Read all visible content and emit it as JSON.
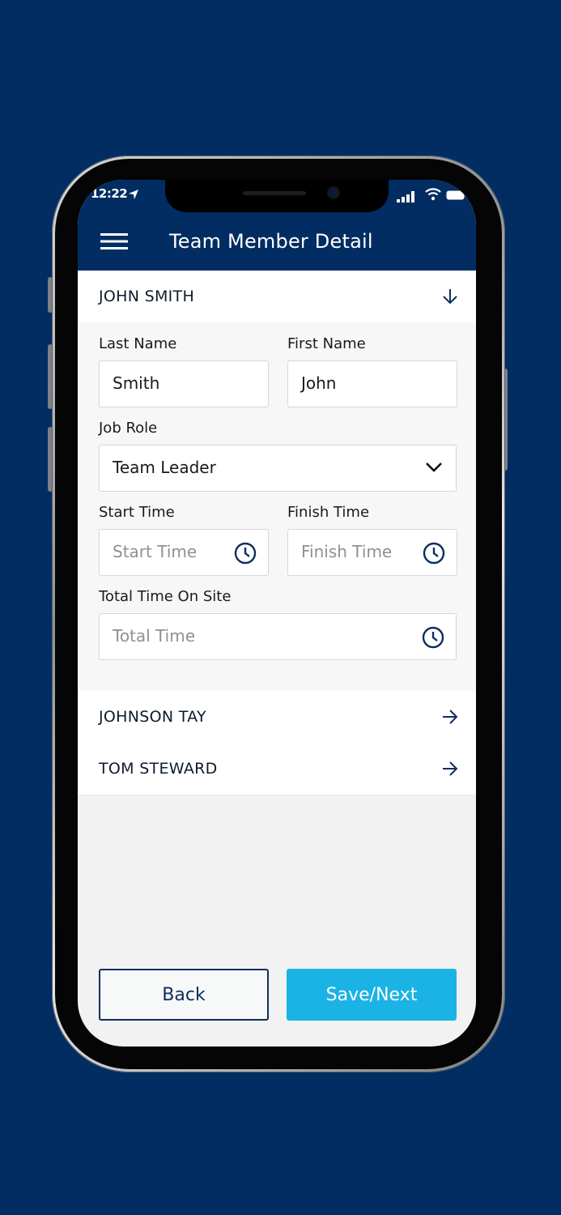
{
  "status_bar": {
    "time": "12:22"
  },
  "header": {
    "title": "Team Member Detail",
    "menu_icon": "hamburger-menu-icon"
  },
  "members": [
    {
      "name": "JOHN SMITH",
      "expanded": true,
      "icon": "arrow-down-icon"
    },
    {
      "name": "JOHNSON TAY",
      "expanded": false,
      "icon": "arrow-right-icon"
    },
    {
      "name": "TOM STEWARD",
      "expanded": false,
      "icon": "arrow-right-icon"
    }
  ],
  "form": {
    "last_name": {
      "label": "Last Name",
      "value": "Smith"
    },
    "first_name": {
      "label": "First Name",
      "value": "John"
    },
    "job_role": {
      "label": "Job Role",
      "value": "Team Leader"
    },
    "start_time": {
      "label": "Start Time",
      "placeholder": "Start Time"
    },
    "finish_time": {
      "label": "Finish Time",
      "placeholder": "Finish Time"
    },
    "total_time": {
      "label": "Total Time On Site",
      "placeholder": "Total Time"
    }
  },
  "actions": {
    "back_label": "Back",
    "save_label": "Save/Next"
  },
  "colors": {
    "background_navy": "#012d62",
    "accent_blue": "#1bb3e6",
    "icon_navy": "#0d2e5e"
  }
}
